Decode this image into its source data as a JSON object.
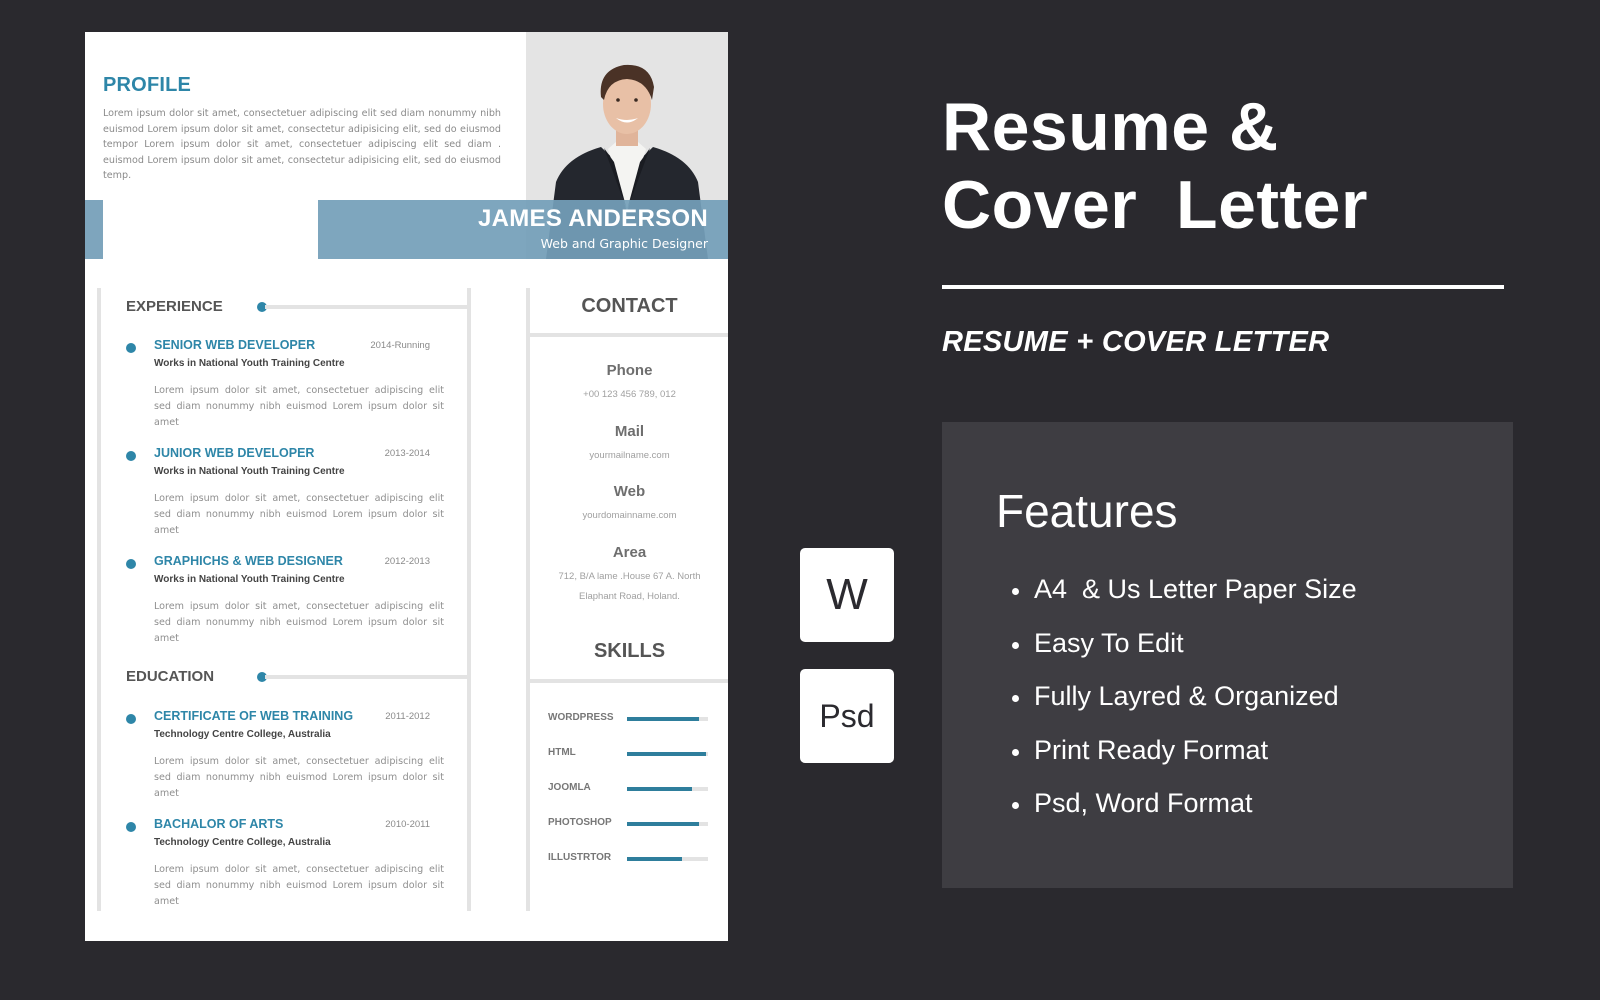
{
  "resume": {
    "profile": {
      "title": "PROFILE",
      "text": "Lorem ipsum dolor sit amet, consectetuer adipiscing elit sed diam nonummy nibh euismod Lorem ipsum dolor sit amet, consectetur adipisicing elit, sed do eiusmod tempor Lorem ipsum dolor sit amet, consectetuer adipiscing elit sed diam . euismod Lorem ipsum dolor sit amet, consectetur adipisicing elit, sed do eiusmod temp."
    },
    "name": "JAMES ANDERSON",
    "job_title": "Web and Graphic Designer",
    "experience": {
      "title": "EXPERIENCE",
      "items": [
        {
          "title": "SENIOR WEB DEVELOPER",
          "date": "2014-Running",
          "org": "Works in National Youth Training Centre",
          "desc": "Lorem ipsum dolor sit amet, consectetuer adipiscing elit sed diam nonummy nibh euismod Lorem ipsum dolor sit amet"
        },
        {
          "title": "JUNIOR WEB DEVELOPER",
          "date": "2013-2014",
          "org": "Works in National Youth Training Centre",
          "desc": "Lorem ipsum dolor sit amet, consectetuer adipiscing elit sed diam nonummy nibh euismod Lorem ipsum dolor sit amet"
        },
        {
          "title": "GRAPHICHS & WEB DESIGNER",
          "date": "2012-2013",
          "org": "Works in National Youth Training Centre",
          "desc": "Lorem ipsum dolor sit amet, consectetuer adipiscing elit sed diam nonummy nibh euismod Lorem ipsum dolor sit amet"
        }
      ]
    },
    "education": {
      "title": "EDUCATION",
      "items": [
        {
          "title": "CERTIFICATE OF WEB TRAINING",
          "date": "2011-2012",
          "org": "Technology Centre College, Australia",
          "desc": "Lorem ipsum dolor sit amet, consectetuer adipiscing elit sed diam nonummy nibh euismod Lorem ipsum dolor sit amet"
        },
        {
          "title": "BACHALOR OF ARTS",
          "date": "2010-2011",
          "org": "Technology Centre College, Australia",
          "desc": "Lorem ipsum dolor sit amet, consectetuer adipiscing elit sed diam nonummy nibh euismod Lorem ipsum dolor sit amet"
        }
      ]
    },
    "contact": {
      "title": "CONTACT",
      "items": [
        {
          "label": "Phone",
          "value": "+00 123 456 789, 012"
        },
        {
          "label": "Mail",
          "value": "yourmailname.com"
        },
        {
          "label": "Web",
          "value": "yourdomainname.com"
        },
        {
          "label": "Area",
          "value": "712, B/A lame .House 67 A. North Elaphant Road, Holand."
        }
      ]
    },
    "skills": {
      "title": "SKILLS",
      "items": [
        {
          "name": "WORDPRESS",
          "level": 0.89
        },
        {
          "name": "HTML",
          "level": 0.97
        },
        {
          "name": "JOOMLA",
          "level": 0.8
        },
        {
          "name": "PHOTOSHOP",
          "level": 0.89
        },
        {
          "name": "ILLUSTRTOR",
          "level": 0.68
        }
      ]
    },
    "colors": {
      "accent": "#2e86a8",
      "band": "#7ea5bd",
      "divider": "#e3e3e3"
    }
  },
  "promo": {
    "title_line1": "Resume &",
    "title_line2": "Cover  Letter",
    "subtitle": "RESUME + COVER LETTER",
    "badges": [
      "W",
      "Psd"
    ],
    "features": {
      "title": "Features",
      "items": [
        "A4  & Us Letter Paper Size",
        "Easy To Edit",
        "Fully Layred & Organized",
        "Print Ready Format",
        "Psd, Word Format"
      ]
    },
    "colors": {
      "background": "#2a292e",
      "panel": "#3e3d42",
      "text": "#ffffff"
    }
  }
}
